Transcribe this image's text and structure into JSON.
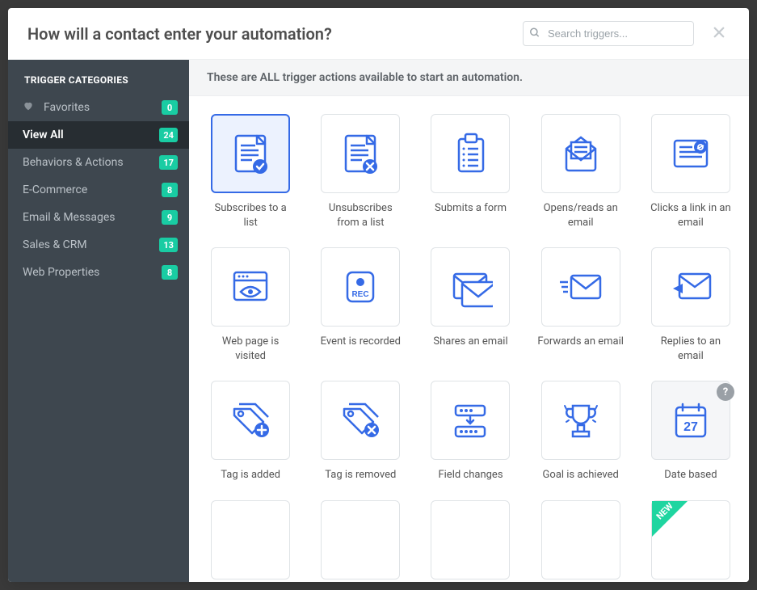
{
  "header": {
    "title": "How will a contact enter your automation?",
    "search_placeholder": "Search triggers...",
    "close_label": "Close",
    "help_label": "?"
  },
  "sidebar": {
    "heading": "TRIGGER CATEGORIES",
    "items": [
      {
        "label": "Favorites",
        "count": 0,
        "icon": "heart"
      },
      {
        "label": "View All",
        "count": 24,
        "active": true
      },
      {
        "label": "Behaviors & Actions",
        "count": 17
      },
      {
        "label": "E-Commerce",
        "count": 8
      },
      {
        "label": "Email & Messages",
        "count": 9
      },
      {
        "label": "Sales & CRM",
        "count": 13
      },
      {
        "label": "Web Properties",
        "count": 8
      }
    ]
  },
  "main": {
    "banner": "These are ALL trigger actions available to start an automation.",
    "new_label": "NEW",
    "triggers": [
      {
        "label": "Subscribes to a list",
        "icon": "doc-check",
        "selected": true
      },
      {
        "label": "Unsubscribes from a list",
        "icon": "doc-x"
      },
      {
        "label": "Submits a form",
        "icon": "clipboard"
      },
      {
        "label": "Opens/reads an email",
        "icon": "envelope-open"
      },
      {
        "label": "Clicks a link in an email",
        "icon": "envelope-link"
      },
      {
        "label": "Web page is visited",
        "icon": "browser-eye"
      },
      {
        "label": "Event is recorded",
        "icon": "rec"
      },
      {
        "label": "Shares an email",
        "icon": "envelope-share"
      },
      {
        "label": "Forwards an email",
        "icon": "envelope-forward"
      },
      {
        "label": "Replies to an email",
        "icon": "envelope-reply"
      },
      {
        "label": "Tag is added",
        "icon": "tag-add"
      },
      {
        "label": "Tag is removed",
        "icon": "tag-remove"
      },
      {
        "label": "Field changes",
        "icon": "field-change"
      },
      {
        "label": "Goal is achieved",
        "icon": "trophy"
      },
      {
        "label": "Date based",
        "icon": "calendar",
        "hover": true
      },
      {
        "label": "",
        "icon": "blank"
      },
      {
        "label": "",
        "icon": "blank"
      },
      {
        "label": "",
        "icon": "blank"
      },
      {
        "label": "",
        "icon": "blank"
      },
      {
        "label": "",
        "icon": "blank",
        "new": true
      }
    ]
  },
  "colors": {
    "accent_blue": "#356ae6",
    "badge_green": "#19cca3",
    "sidebar_bg": "#3e474f",
    "active_row": "#272d32"
  }
}
